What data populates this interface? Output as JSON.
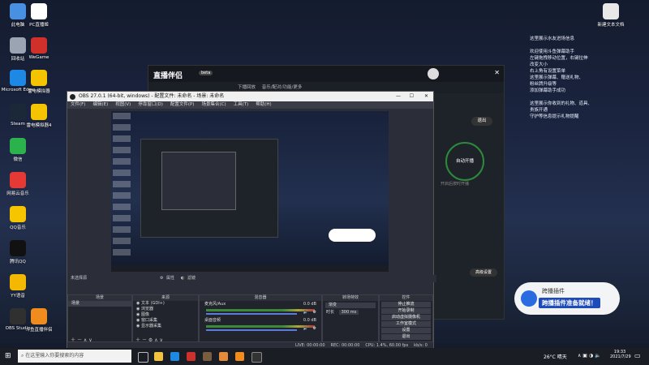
{
  "desktop": {
    "icons_left": [
      {
        "label": "此电脑",
        "color": "#4a90e2"
      },
      {
        "label": "回收站",
        "color": "#9aa4b2"
      },
      {
        "label": "Microsoft Edge",
        "color": "#1e88e5"
      },
      {
        "label": "Steam",
        "color": "#1b2838"
      },
      {
        "label": "微信",
        "color": "#2bb24c"
      },
      {
        "label": "网易云音乐",
        "color": "#e53935"
      },
      {
        "label": "QQ音乐",
        "color": "#f7c400"
      },
      {
        "label": "腾讯QQ",
        "color": "#111111"
      },
      {
        "label": "YY语音",
        "color": "#f5b800"
      },
      {
        "label": "OBS Studio",
        "color": "#303030"
      }
    ],
    "icons_col2": [
      {
        "label": "PC直播姬",
        "color": "#ffffff"
      },
      {
        "label": "WeGame",
        "color": "#d0302b"
      },
      {
        "label": "雷电模拟器",
        "color": "#f5c400"
      },
      {
        "label": "雷电模拟器4",
        "color": "#f5c400"
      },
      {
        "label": "斗鱼直播伴侣",
        "color": "#f08c1e"
      }
    ],
    "icon_topright": {
      "label": "新建文本文档",
      "color": "#e8e8e8"
    }
  },
  "right_panel": {
    "lines": [
      "这里展示水友进场信息",
      "",
      "欢迎使用斗鱼弹幕助手",
      "左键拖拽移动位置，右键拉伸",
      "改变大小",
      "右上角有设置菜单",
      "这里展示弹幕、赠送礼物、",
      "粉丝牌升级等",
      "添加弹幕助手成功",
      "",
      "这里展示你收到的礼物、道具、",
      "贵族开通",
      "守护等信息提示礼物提醒"
    ]
  },
  "behind_app": {
    "title": "直播伴侣",
    "badge": "beta",
    "tabs": [
      "下播回放",
      "音乐/配对/功能/更多"
    ],
    "stop_button": "退出",
    "status_text": "自动开播",
    "desc": "开启后按时开播",
    "record": "自动开播",
    "bottom": "高级设置"
  },
  "obs": {
    "title": "OBS 27.0.1 (64-bit, windows) - 配置文件: 未命名 - 场景: 未命名",
    "menu": [
      "文件(F)",
      "编辑(E)",
      "视图(V)",
      "停靠窗口(D)",
      "配置文件(P)",
      "场景集合(C)",
      "工具(T)",
      "帮助(H)"
    ],
    "source_bar": "未选择源",
    "properties": "属性",
    "filters": "滤镜",
    "docks": {
      "scenes": {
        "title": "场景",
        "items": [
          "场景"
        ]
      },
      "sources": {
        "title": "来源",
        "items": [
          "文本 (GDI+)",
          "浏览器",
          "图像",
          "窗口采集",
          "显示器采集"
        ]
      },
      "mixer": {
        "title": "混音器",
        "channels": [
          {
            "name": "麦克风/Aux",
            "db": "0.0 dB"
          },
          {
            "name": "桌面音频",
            "db": "0.0 dB"
          }
        ]
      },
      "transitions": {
        "title": "转场特效",
        "type": "渐变",
        "duration_label": "时长",
        "duration": "300 ms"
      },
      "controls": {
        "title": "控件",
        "buttons": [
          "停止推流",
          "开始录制",
          "启动虚拟摄像机",
          "工作室模式",
          "设置",
          "退出"
        ]
      }
    },
    "status": [
      "LIVE: 00:00:00",
      "REC: 00:00:00",
      "CPU: 1.4%, 60.00 fps",
      "kb/s: 0"
    ]
  },
  "toast": {
    "title": "跨播插件",
    "message": "跨播插件准备就绪！"
  },
  "taskbar": {
    "search_placeholder": "在这里输入你要搜索的内容",
    "weather": "26°C 晴天",
    "time": "19:33",
    "date": "2021/7/29"
  }
}
